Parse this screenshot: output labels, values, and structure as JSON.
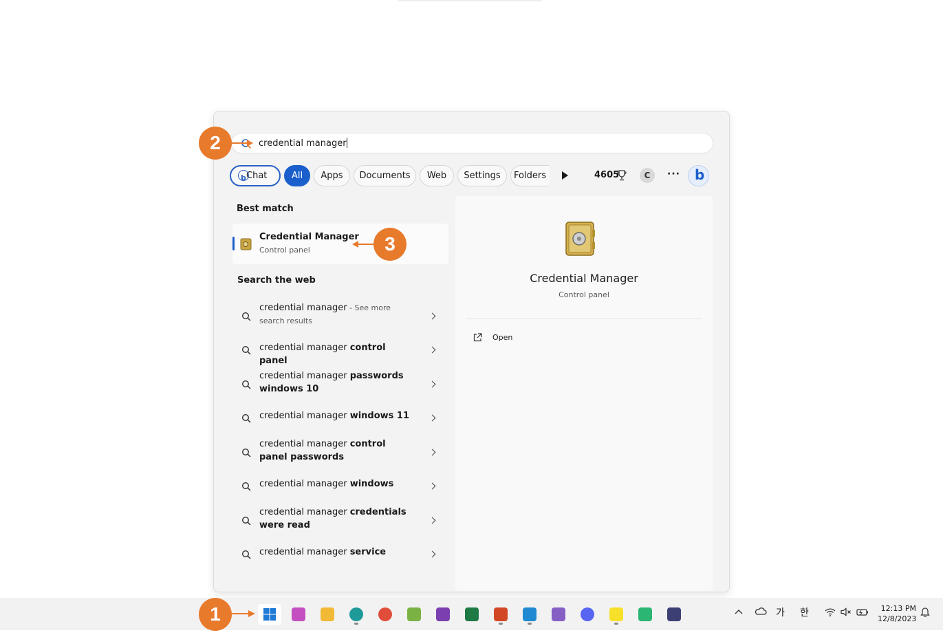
{
  "search": {
    "query": "credential manager"
  },
  "filters": {
    "chat": "Chat",
    "all": "All",
    "apps": "Apps",
    "documents": "Documents",
    "web": "Web",
    "settings": "Settings",
    "folders": "Folders",
    "points": "4605",
    "avatar_letter": "C",
    "more": "···"
  },
  "best_match": {
    "heading": "Best match",
    "title": "Credential Manager",
    "subtitle": "Control panel"
  },
  "search_web": {
    "heading": "Search the web",
    "items": [
      {
        "plain": "credential manager",
        "bold": "",
        "suffix": " - See more search results"
      },
      {
        "plain": "credential manager ",
        "bold": "control panel",
        "suffix": ""
      },
      {
        "plain": "credential manager ",
        "bold": "passwords windows 10",
        "suffix": ""
      },
      {
        "plain": "credential manager ",
        "bold": "windows 11",
        "suffix": ""
      },
      {
        "plain": "credential manager ",
        "bold": "control panel passwords",
        "suffix": ""
      },
      {
        "plain": "credential manager ",
        "bold": "windows",
        "suffix": ""
      },
      {
        "plain": "credential manager ",
        "bold": "credentials were read",
        "suffix": ""
      },
      {
        "plain": "credential manager ",
        "bold": "service",
        "suffix": ""
      }
    ]
  },
  "detail": {
    "title": "Credential Manager",
    "subtitle": "Control panel",
    "open_label": "Open"
  },
  "callouts": {
    "one": "1",
    "two": "2",
    "three": "3"
  },
  "taskbar": {
    "apps": [
      {
        "name": "start",
        "color": "#1f7ad6"
      },
      {
        "name": "copilot-pre",
        "color": "#c44fc0"
      },
      {
        "name": "file-explorer",
        "color": "#f2b936"
      },
      {
        "name": "edge",
        "color": "#1e9a9a"
      },
      {
        "name": "chrome",
        "color": "#e14d3b"
      },
      {
        "name": "notepad-plus",
        "color": "#7bb244"
      },
      {
        "name": "onenote",
        "color": "#7b3fb0"
      },
      {
        "name": "excel",
        "color": "#1d7a45"
      },
      {
        "name": "powerpoint",
        "color": "#d24726"
      },
      {
        "name": "vscode",
        "color": "#1f8ad2"
      },
      {
        "name": "visual-studio",
        "color": "#865fc5"
      },
      {
        "name": "discord",
        "color": "#5865f2"
      },
      {
        "name": "kakaotalk",
        "color": "#f7e02a"
      },
      {
        "name": "snipping",
        "color": "#2bb673"
      },
      {
        "name": "app-window",
        "color": "#3b3f73"
      }
    ],
    "tray": {
      "ime_a": "가",
      "ime_b": "한",
      "time": "12:13 PM",
      "date": "12/8/2023"
    }
  }
}
